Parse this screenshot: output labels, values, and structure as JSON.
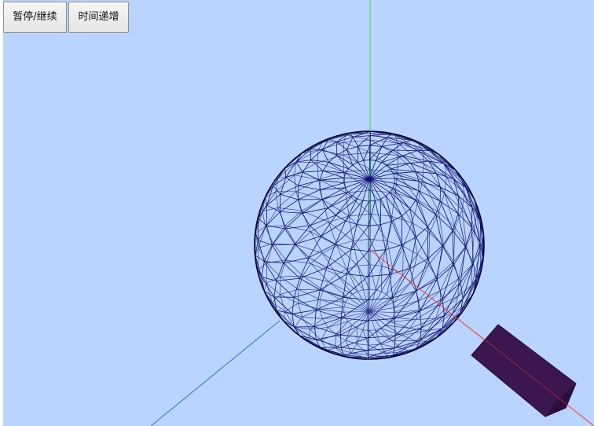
{
  "toolbar": {
    "pause_resume_label": "暂停/继续",
    "time_increment_label": "时间递增"
  },
  "scene": {
    "background_color": "#b9d4ff",
    "sphere_wire_color": "#12126e",
    "sphere_rim_color": "#05052a",
    "axis_x_color": "#ff3a3a",
    "axis_y_color": "#38e038",
    "axis_z_color": "#2e6fd0",
    "box_color": "#3b1650",
    "box_edge_color": "#240a33"
  }
}
